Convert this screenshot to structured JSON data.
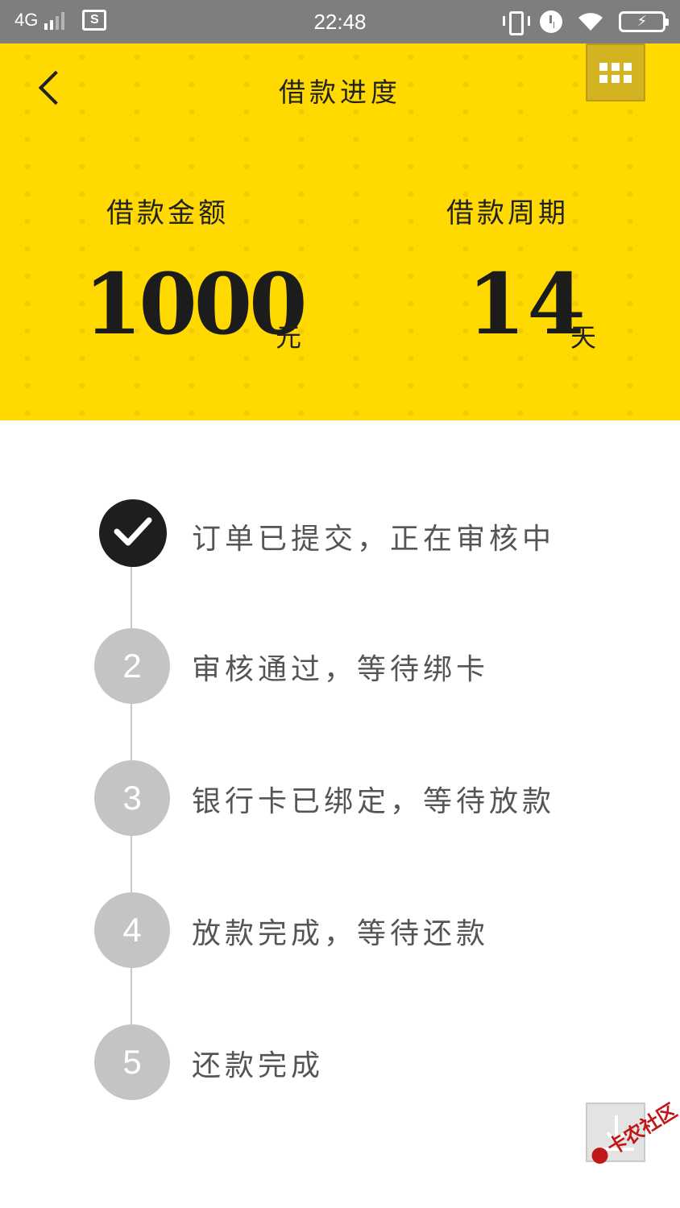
{
  "status_bar": {
    "network": "4G",
    "time": "22:48",
    "battery_text": "⚡"
  },
  "header": {
    "title": "借款进度",
    "amount_label": "借款金额",
    "amount_value": "1000",
    "amount_unit": "元",
    "period_label": "借款周期",
    "period_value": "14",
    "period_unit": "天",
    "background_color": "#ffd900"
  },
  "steps": [
    {
      "number": "",
      "label": "订单已提交，正在审核中",
      "status": "done"
    },
    {
      "number": "2",
      "label": "审核通过，等待绑卡",
      "status": "pending"
    },
    {
      "number": "3",
      "label": "银行卡已绑定，等待放款",
      "status": "pending"
    },
    {
      "number": "4",
      "label": "放款完成，等待还款",
      "status": "pending"
    },
    {
      "number": "5",
      "label": "还款完成",
      "status": "pending"
    }
  ],
  "watermark": "卡农社区",
  "icons": {
    "back": "back-arrow-icon",
    "menu": "grid-menu-icon",
    "download": "download-icon",
    "done": "checkmark-icon"
  }
}
